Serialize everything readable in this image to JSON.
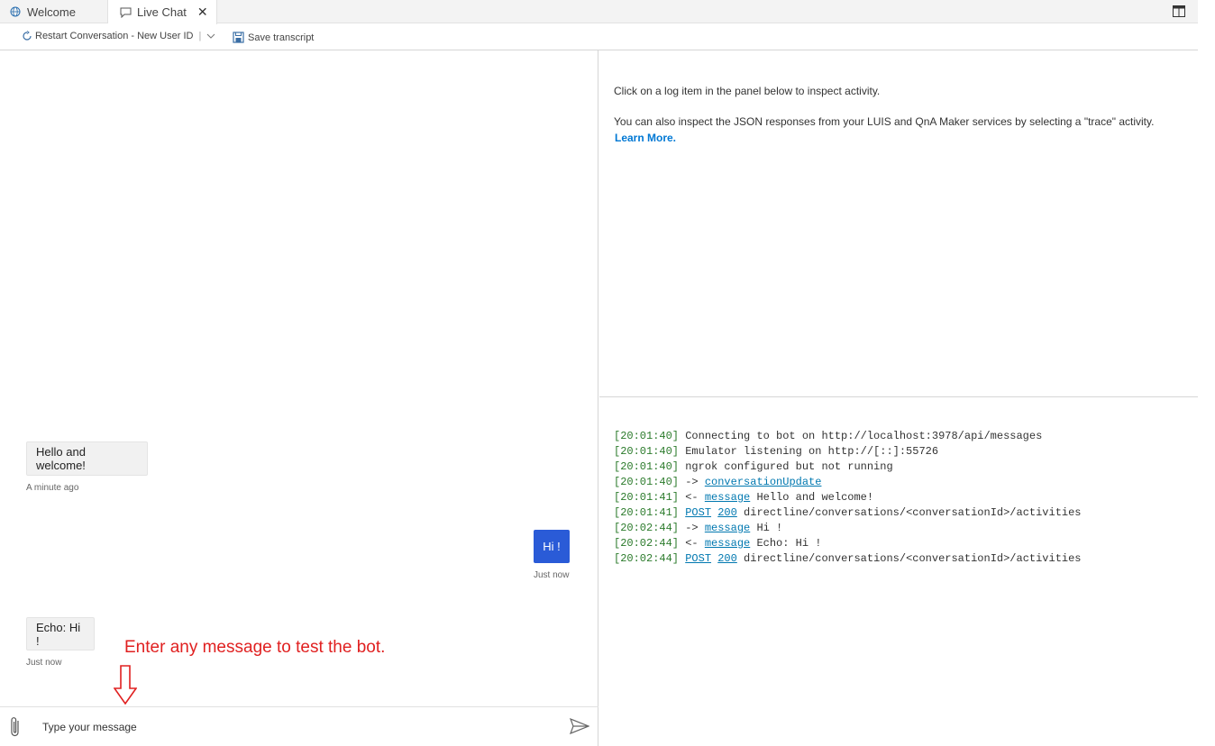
{
  "tabs": [
    {
      "label": "Welcome"
    },
    {
      "label": "Live Chat",
      "close": "✕"
    }
  ],
  "toolbar": {
    "restart_label": "Restart Conversation - New User ID",
    "save_label": "Save transcript"
  },
  "chat": {
    "messages": [
      {
        "text": "Hello and welcome!",
        "time": "A minute ago",
        "from": "bot"
      },
      {
        "text": "Hi !",
        "time": "Just now",
        "from": "user"
      },
      {
        "text": "Echo: Hi !",
        "time": "Just now",
        "from": "bot"
      }
    ],
    "annotation": "Enter any message to test the bot.",
    "input_placeholder": "Type your message"
  },
  "inspector": {
    "line1": "Click on a log item in the panel below to inspect activity.",
    "line2": "You can also inspect the JSON responses from your LUIS and QnA Maker services by selecting a \"trace\" activity.",
    "learn_more": "Learn More."
  },
  "log": [
    {
      "time": "[20:01:40]",
      "text": " Connecting to bot on http://localhost:3978/api/messages"
    },
    {
      "time": "[20:01:40]",
      "text": " Emulator listening on http://[::]:55726"
    },
    {
      "time": "[20:01:40]",
      "text": " ngrok configured but not running"
    },
    {
      "time": "[20:01:40]",
      "pre": " -> ",
      "link": "conversationUpdate",
      "rest": ""
    },
    {
      "time": "[20:01:41]",
      "pre": " <- ",
      "link": "message",
      "rest": " Hello and welcome!"
    },
    {
      "time": "[20:01:41]",
      "pre": " ",
      "link": "POST",
      "mid": " ",
      "link2": "200",
      "rest": " directline/conversations/<conversationId>/activities"
    },
    {
      "time": "[20:02:44]",
      "pre": " -> ",
      "link": "message",
      "rest": " Hi !"
    },
    {
      "time": "[20:02:44]",
      "pre": " <- ",
      "link": "message",
      "rest": " Echo: Hi !"
    },
    {
      "time": "[20:02:44]",
      "pre": " ",
      "link": "POST",
      "mid": " ",
      "link2": "200",
      "rest": " directline/conversations/<conversationId>/activities"
    }
  ],
  "colors": {
    "accent": "#2a5bd7",
    "link": "#0078d4",
    "annotation": "#e02020",
    "timestamp": "#2a7a2a"
  }
}
